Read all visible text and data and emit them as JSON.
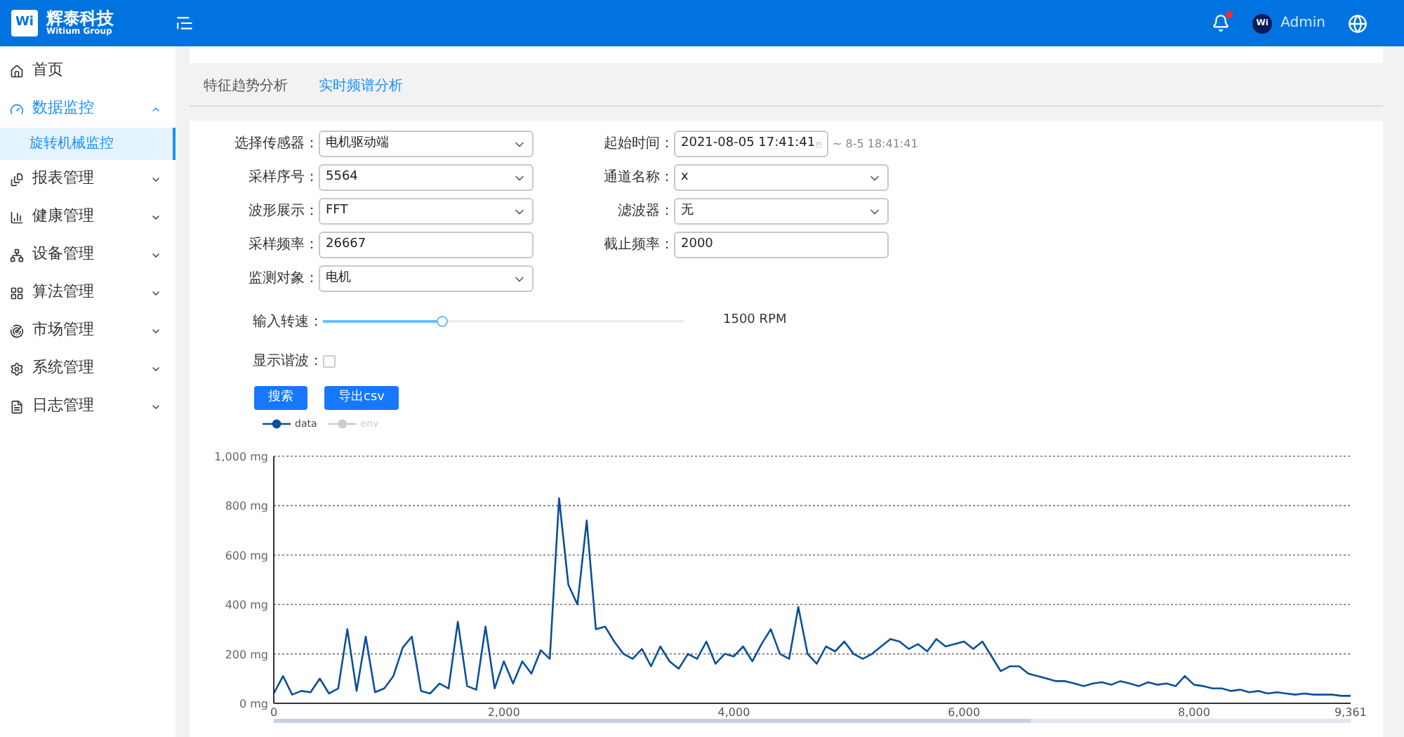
{
  "header": {
    "brand": "辉泰科技",
    "brand_sub": "Witium Group",
    "logo": "Wi",
    "notification_unread": true,
    "user": {
      "avatar": "Wi",
      "name": "Admin"
    }
  },
  "sidebar": {
    "items": [
      {
        "label": "首页",
        "selected": false
      },
      {
        "label": "数据监控",
        "selected": true,
        "expanded": true,
        "children": [
          {
            "label": "旋转机械监控",
            "selected": true
          }
        ]
      },
      {
        "label": "报表管理",
        "selected": false,
        "expanded": false
      },
      {
        "label": "健康管理",
        "selected": false,
        "expanded": false
      },
      {
        "label": "设备管理",
        "selected": false,
        "expanded": false
      },
      {
        "label": "算法管理",
        "selected": false,
        "expanded": false
      },
      {
        "label": "市场管理",
        "selected": false,
        "expanded": false
      },
      {
        "label": "系统管理",
        "selected": false,
        "expanded": false
      },
      {
        "label": "日志管理",
        "selected": false,
        "expanded": false
      }
    ]
  },
  "tabs": [
    {
      "label": "特征趋势分析",
      "selected": false
    },
    {
      "label": "实时频谱分析",
      "selected": true
    }
  ],
  "form": {
    "left": [
      {
        "label": "选择传感器：",
        "kind": "select",
        "value": "电机驱动端"
      },
      {
        "label": "采样序号：",
        "kind": "select",
        "value": "5564"
      },
      {
        "label": "波形展示：",
        "kind": "select",
        "value": "FFT"
      },
      {
        "label": "采样频率：",
        "kind": "input",
        "value": "26667"
      },
      {
        "label": "监测对象：",
        "kind": "select",
        "value": "电机"
      }
    ],
    "right": [
      {
        "label": "起始时间：",
        "kind": "date",
        "value": "2021-08-05 17:41:41",
        "suffix": "~ 8-5 18:41:41"
      },
      {
        "label": "通道名称：",
        "kind": "select",
        "value": "x"
      },
      {
        "label": "滤波器：",
        "kind": "select",
        "value": "无"
      },
      {
        "label": "截止频率：",
        "kind": "input",
        "value": "2000"
      }
    ],
    "speed": {
      "label": "输入转速：",
      "level": 0.33,
      "reading": "1500 RPM"
    },
    "harmonic": {
      "label": "显示谐波：",
      "checked": false
    },
    "buttons": [
      "搜索",
      "导出csv"
    ]
  },
  "chart_data": {
    "type": "line",
    "grid": true,
    "xlim": [
      0,
      9361
    ],
    "ylim": [
      0,
      1000
    ],
    "x": [
      0,
      80,
      160,
      240,
      320,
      400,
      480,
      560,
      640,
      720,
      800,
      880,
      960,
      1040,
      1120,
      1200,
      1280,
      1360,
      1440,
      1520,
      1600,
      1680,
      1760,
      1840,
      1920,
      2000,
      2080,
      2160,
      2240,
      2320,
      2400,
      2480,
      2560,
      2640,
      2720,
      2800,
      2880,
      2960,
      3040,
      3120,
      3200,
      3280,
      3360,
      3440,
      3520,
      3600,
      3680,
      3760,
      3840,
      3920,
      4000,
      4080,
      4160,
      4240,
      4320,
      4400,
      4480,
      4560,
      4640,
      4720,
      4800,
      4880,
      4960,
      5040,
      5120,
      5200,
      5280,
      5360,
      5440,
      5520,
      5600,
      5680,
      5760,
      5840,
      5920,
      6000,
      6080,
      6160,
      6240,
      6320,
      6400,
      6480,
      6560,
      6640,
      6720,
      6800,
      6880,
      6960,
      7040,
      7120,
      7200,
      7280,
      7360,
      7440,
      7520,
      7600,
      7680,
      7760,
      7840,
      7920,
      8000,
      8080,
      8160,
      8240,
      8320,
      8400,
      8480,
      8560,
      8640,
      8720,
      8800,
      8880,
      8960,
      9040,
      9120,
      9200,
      9280,
      9361
    ],
    "xticks": [
      {
        "value": 0,
        "label": "0"
      },
      {
        "value": 2000,
        "label": "2,000"
      },
      {
        "value": 4000,
        "label": "4,000"
      },
      {
        "value": 6000,
        "label": "6,000"
      },
      {
        "value": 8000,
        "label": "8,000"
      },
      {
        "value": 9361,
        "label": "9,361"
      }
    ],
    "yticks": [
      {
        "value": 0,
        "label": "0 mg"
      },
      {
        "value": 200,
        "label": "200 mg"
      },
      {
        "value": 400,
        "label": "400 mg"
      },
      {
        "value": 600,
        "label": "600 mg"
      },
      {
        "value": 800,
        "label": "800 mg"
      },
      {
        "value": 1000,
        "label": "1,000 mg"
      }
    ],
    "series": [
      {
        "name": "data",
        "color": "#0a4f9e",
        "values": [
          40,
          110,
          35,
          50,
          45,
          100,
          40,
          60,
          300,
          50,
          270,
          45,
          60,
          110,
          225,
          270,
          50,
          40,
          80,
          60,
          330,
          70,
          55,
          310,
          60,
          170,
          80,
          170,
          120,
          215,
          180,
          830,
          480,
          400,
          740,
          300,
          310,
          250,
          200,
          180,
          220,
          150,
          230,
          170,
          140,
          200,
          180,
          250,
          160,
          200,
          190,
          230,
          170,
          240,
          300,
          200,
          180,
          390,
          200,
          160,
          230,
          210,
          250,
          200,
          180,
          200,
          230,
          260,
          250,
          220,
          240,
          210,
          260,
          230,
          240,
          250,
          220,
          250,
          190,
          130,
          150,
          150,
          120,
          110,
          100,
          90,
          90,
          80,
          70,
          80,
          85,
          75,
          90,
          80,
          70,
          85,
          75,
          80,
          70,
          110,
          75,
          70,
          60,
          60,
          50,
          55,
          45,
          50,
          40,
          45,
          40,
          35,
          40,
          35,
          35,
          35,
          30,
          30
        ]
      }
    ]
  },
  "legend": [
    {
      "label": "env",
      "on": false
    }
  ]
}
